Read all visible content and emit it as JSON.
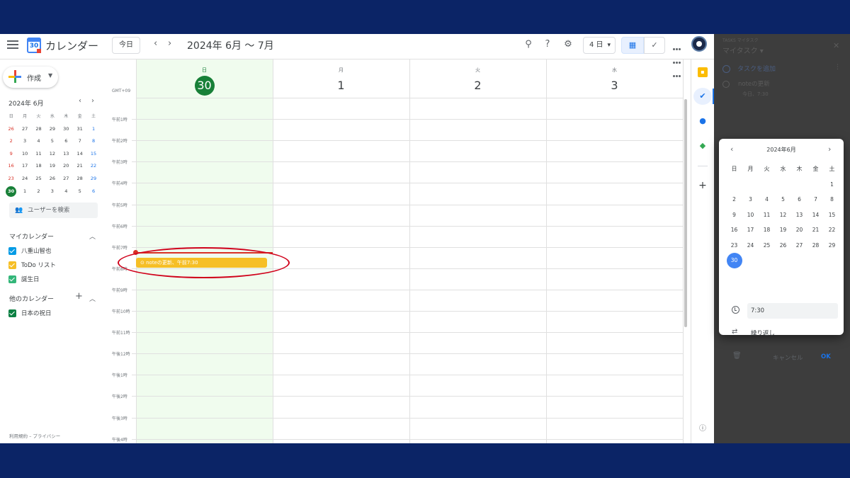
{
  "header": {
    "app_title": "カレンダー",
    "logo_day": "30",
    "today_button": "今日",
    "prev_icon": "chevron-left-icon",
    "next_icon": "chevron-right-icon",
    "date_range": "2024年 6月 〜 7月",
    "view_select": "4 日",
    "accent_color": "#1a73e8"
  },
  "sidebar": {
    "create_label": "作成",
    "mini_calendar": {
      "title": "2024年 6月",
      "weekdays": [
        "日",
        "月",
        "火",
        "水",
        "木",
        "金",
        "土"
      ],
      "weeks": [
        [
          "26",
          "27",
          "28",
          "29",
          "30",
          "31",
          "1"
        ],
        [
          "2",
          "3",
          "4",
          "5",
          "6",
          "7",
          "8"
        ],
        [
          "9",
          "10",
          "11",
          "12",
          "13",
          "14",
          "15"
        ],
        [
          "16",
          "17",
          "18",
          "19",
          "20",
          "21",
          "22"
        ],
        [
          "23",
          "24",
          "25",
          "26",
          "27",
          "28",
          "29"
        ],
        [
          "30",
          "1",
          "2",
          "3",
          "4",
          "5",
          "6"
        ]
      ],
      "today": "30"
    },
    "people_search_placeholder": "ユーザーを検索",
    "my_calendars_title": "マイカレンダー",
    "my_calendars": [
      {
        "label": "八重山智也",
        "color": "#039be5"
      },
      {
        "label": "ToDo リスト",
        "color": "#f6bf26"
      },
      {
        "label": "誕生日",
        "color": "#33b679"
      }
    ],
    "other_calendars_title": "他のカレンダー",
    "other_calendars": [
      {
        "label": "日本の祝日",
        "color": "#0b8043"
      }
    ],
    "footer": "利用規約 – プライバシー"
  },
  "grid": {
    "timezone": "GMT+09",
    "today_color": "#188038",
    "days": [
      {
        "name": "日",
        "num": "30",
        "today": true
      },
      {
        "name": "月",
        "num": "1",
        "today": false
      },
      {
        "name": "火",
        "num": "2",
        "today": false
      },
      {
        "name": "水",
        "num": "3",
        "today": false
      }
    ],
    "hours": [
      "午前1時",
      "午前2時",
      "午前3時",
      "午前4時",
      "午前5時",
      "午前6時",
      "午前7時",
      "午前8時",
      "午前9時",
      "午前10時",
      "午前11時",
      "午後12時",
      "午後1時",
      "午後2時",
      "午後3時",
      "午後4時"
    ],
    "event": {
      "label": "noteの更新、午前7:30",
      "color": "#f6bf26"
    }
  },
  "rail": {
    "keep_icon": "keep-icon",
    "tasks_icon": "tasks-icon",
    "contacts_icon": "contacts-icon",
    "maps_icon": "maps-icon",
    "add_icon": "plus-icon",
    "info_icon": "info-icon"
  },
  "tasks_panel": {
    "small_title": "TASKS マイタスク",
    "title": "マイタスク ▾",
    "add_task": "タスクを追加",
    "task_title": "noteの更新",
    "task_sub": "今日、7:30"
  },
  "date_picker": {
    "title": "2024年6月",
    "weekdays": [
      "日",
      "月",
      "火",
      "水",
      "木",
      "金",
      "土"
    ],
    "weeks": [
      [
        "",
        "",
        "",
        "",
        "",
        "",
        "1"
      ],
      [
        "2",
        "3",
        "4",
        "5",
        "6",
        "7",
        "8"
      ],
      [
        "9",
        "10",
        "11",
        "12",
        "13",
        "14",
        "15"
      ],
      [
        "16",
        "17",
        "18",
        "19",
        "20",
        "21",
        "22"
      ],
      [
        "23",
        "24",
        "25",
        "26",
        "27",
        "28",
        "29"
      ],
      [
        "30",
        "",
        "",
        "",
        "",
        "",
        ""
      ]
    ],
    "selected": "30",
    "time": "7:30",
    "repeat": "繰り返し",
    "cancel": "キャンセル",
    "ok": "OK"
  }
}
